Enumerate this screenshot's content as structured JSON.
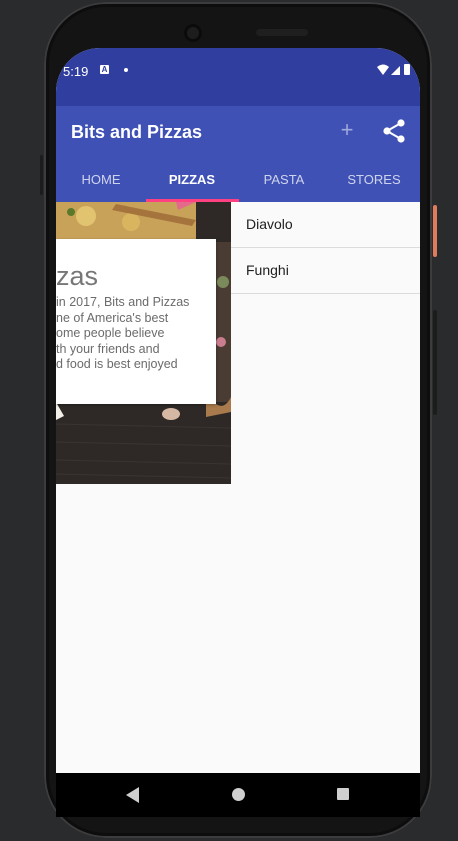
{
  "status_bar": {
    "time": "5:19",
    "notification_letter": "A"
  },
  "toolbar": {
    "title": "Bits and Pizzas",
    "add_icon": "+"
  },
  "tabs": [
    {
      "label": "HOME",
      "active": false
    },
    {
      "label": "PIZZAS",
      "active": true
    },
    {
      "label": "PASTA",
      "active": false
    },
    {
      "label": "STORES",
      "active": false
    }
  ],
  "card": {
    "title_fragment": "zas",
    "lines": [
      " in 2017, Bits and Pizzas",
      "ne of America's best",
      "ome people believe",
      "th your friends and",
      "d food is best enjoyed"
    ]
  },
  "pizzas": [
    "Diavolo",
    "Funghi"
  ],
  "colors": {
    "primary": "#3f51b5",
    "primary_dark": "#303f9f",
    "accent": "#ff4081"
  }
}
